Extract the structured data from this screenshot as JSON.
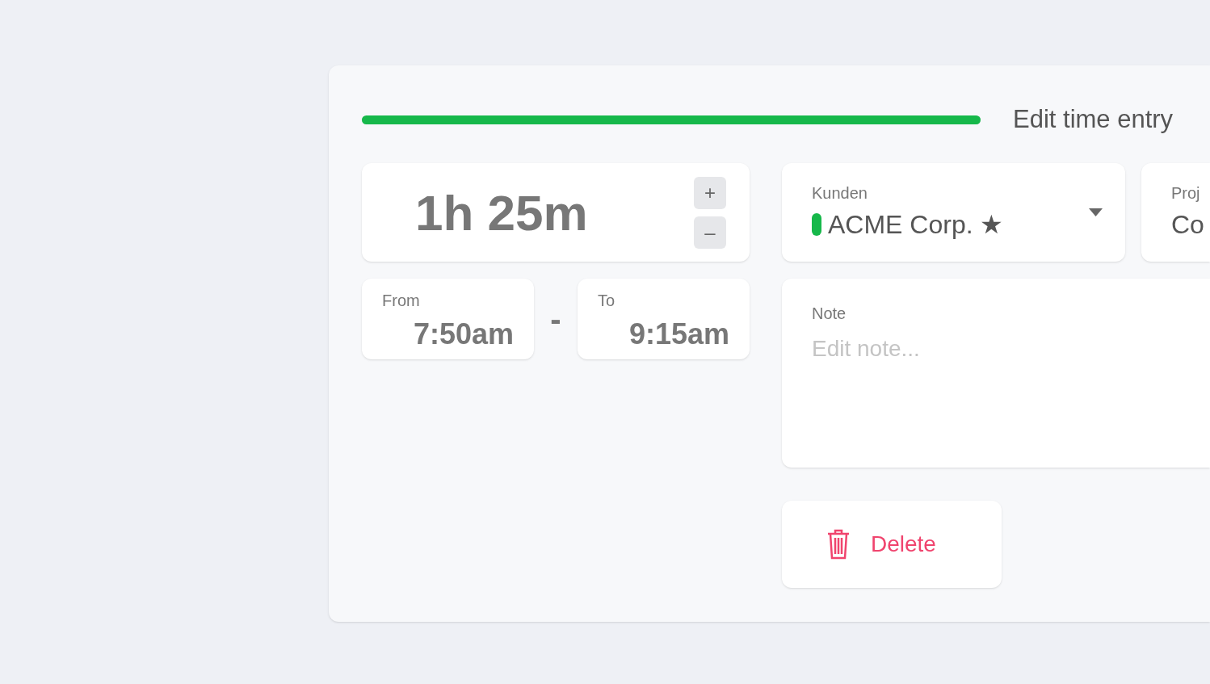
{
  "progress": {
    "level": 1
  },
  "title": "Edit time entry",
  "duration": {
    "value": "1h 25m",
    "increase": "+",
    "decrease": "–"
  },
  "from": {
    "label": "From",
    "value": "7:50am"
  },
  "separator": "-",
  "to": {
    "label": "To",
    "value": "9:15am"
  },
  "customer": {
    "label": "Kunden",
    "value": "ACME Corp. ★",
    "color": "#16b84a"
  },
  "project": {
    "label": "Proj",
    "value": "Co"
  },
  "note": {
    "label": "Note",
    "placeholder": "Edit note..."
  },
  "delete_button": {
    "label": "Delete"
  }
}
